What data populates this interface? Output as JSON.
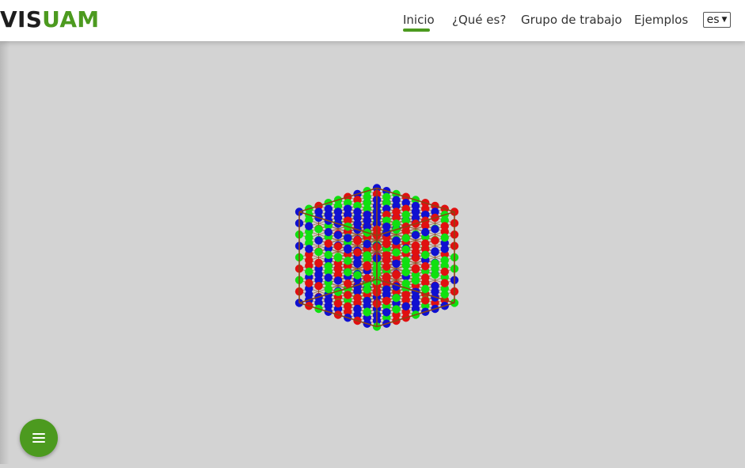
{
  "header": {
    "logo_part1": "VIS",
    "logo_part2": "UAM",
    "nav": [
      "Inicio",
      "¿Qué es?",
      "Grupo de trabajo",
      "Ejemplos"
    ],
    "active_nav": "Inicio",
    "language": "es"
  },
  "colors": {
    "accent": "#4c9a1f",
    "viewer_background": "#d3d3d3",
    "atom_red": "#e01010",
    "atom_green": "#10e010",
    "atom_blue": "#1010d0",
    "bond": "#8b4513"
  },
  "viewer": {
    "model": "cubic-crystal-lattice"
  },
  "fab": {
    "icon": "menu-icon"
  }
}
